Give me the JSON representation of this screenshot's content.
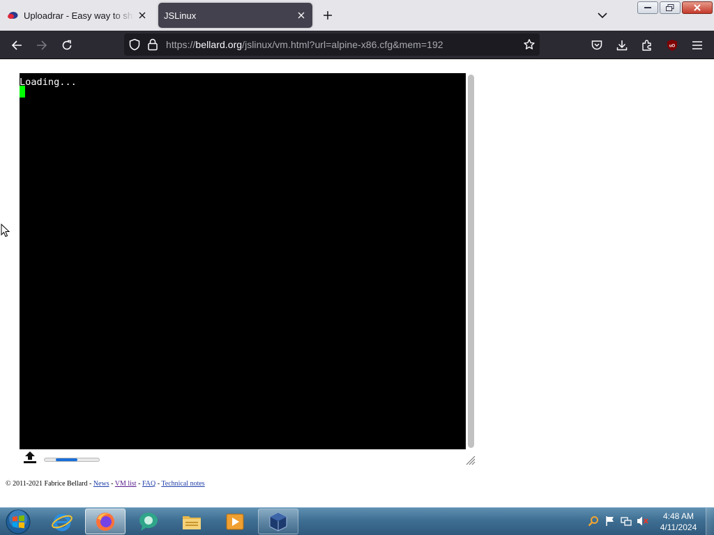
{
  "browser": {
    "tabs": [
      {
        "title": "Uploadrar - Easy way to share y",
        "active": false
      },
      {
        "title": "JSLinux",
        "active": true
      }
    ],
    "url": {
      "scheme": "https://",
      "host": "bellard.org",
      "path": "/jslinux/vm.html?url=alpine-x86.cfg&mem=192"
    }
  },
  "terminal": {
    "lines": [
      "Loading..."
    ],
    "background": "#000000",
    "cursor_color": "#00ff00"
  },
  "upload_progress": 0.6,
  "footer": {
    "copyright": "© 2011-2021 Fabrice Bellard - ",
    "sep": " - ",
    "links": [
      "News",
      "VM list",
      "FAQ",
      "Technical notes"
    ]
  },
  "taskbar": {
    "items": [
      "Internet Explorer",
      "Firefox",
      "Messenger",
      "File Explorer",
      "Media Player",
      "VirtualBox"
    ],
    "clock": {
      "time": "4:48 AM",
      "date": "4/11/2024"
    }
  },
  "colors": {
    "accent": "#1a6fd8",
    "tab_active": "#42414d",
    "toolbar": "#2b2a33"
  }
}
